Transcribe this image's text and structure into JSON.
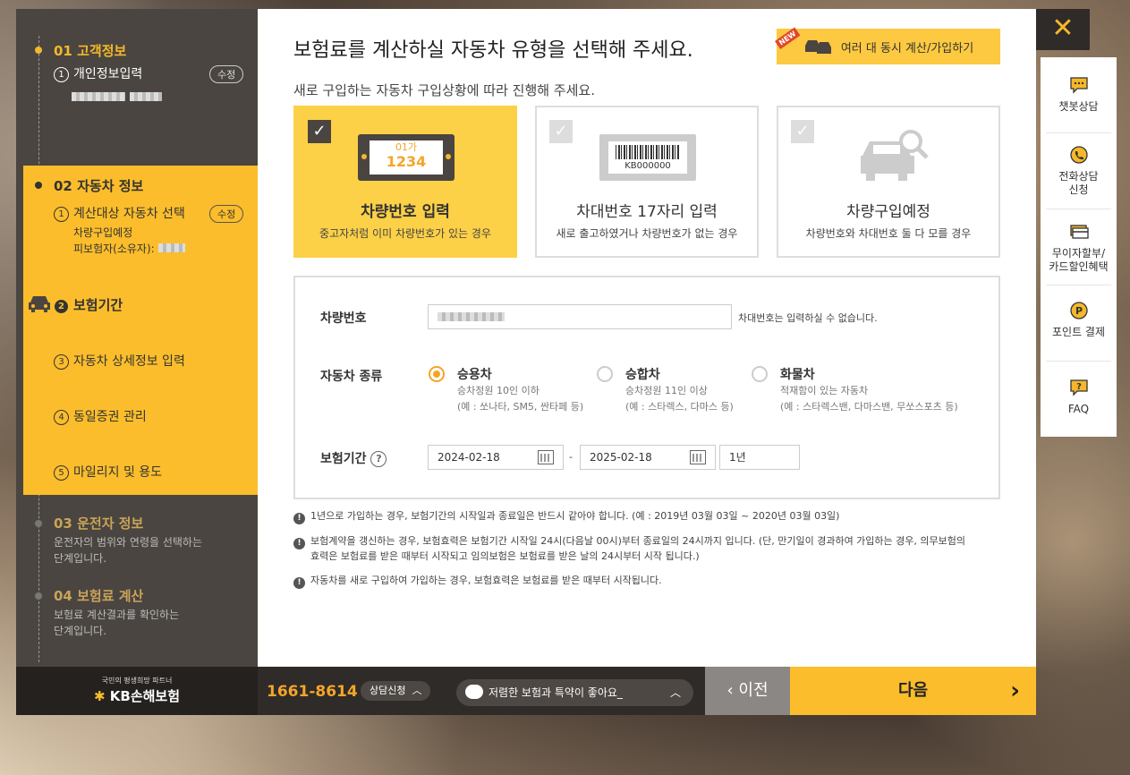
{
  "sidebar": {
    "step1": {
      "num": "01",
      "title": "고객정보",
      "sub_num": "1",
      "sub_label": "개인정보입력",
      "edit": "수정"
    },
    "step2": {
      "num": "02",
      "title": "자동차 정보",
      "sub_num": "1",
      "sub_label": "계산대상 자동차 선택",
      "edit": "수정",
      "detail1": "차량구입예정",
      "detail2": "피보험자(소유자):",
      "items": [
        {
          "num": "2",
          "label": "보험기간"
        },
        {
          "num": "3",
          "label": "자동차 상세정보 입력"
        },
        {
          "num": "4",
          "label": "동일증권 관리"
        },
        {
          "num": "5",
          "label": "마일리지 및 용도"
        }
      ]
    },
    "step3": {
      "num": "03",
      "title": "운전자 정보",
      "desc1": "운전자의 범위와 연령을 선택하는",
      "desc2": "단계입니다."
    },
    "step4": {
      "num": "04",
      "title": "보험료 계산",
      "desc1": "보험료 계산결과를 확인하는",
      "desc2": "단계입니다."
    }
  },
  "main": {
    "heading": "보험료를 계산하실 자동차 유형을 선택해 주세요.",
    "subheading": "새로 구입하는 자동차 구입상황에 따라 진행해 주세요.",
    "multi_button": {
      "badge": "NEW",
      "label": "여러 대 동시 계산/가입하기"
    },
    "cards": [
      {
        "title": "차량번호 입력",
        "desc": "중고자처럼 이미 차량번호가 있는 경우",
        "plate_top": "01가",
        "plate_num": "1234",
        "selected": true
      },
      {
        "title": "차대번호 17자리 입력",
        "desc": "새로 출고하였거나 차량번호가 없는 경우",
        "code": "KB000000",
        "selected": false
      },
      {
        "title": "차량구입예정",
        "desc": "차량번호와 차대번호 둘 다 모를 경우",
        "selected": false
      }
    ],
    "form": {
      "plate_label": "차량번호",
      "plate_note": "차대번호는 입력하실 수 없습니다.",
      "type_label": "자동차 종류",
      "types": [
        {
          "title": "승용차",
          "sub1": "승차정원 10인 이하",
          "sub2": "(예 : 쏘나타, SM5, 싼타페 등)",
          "checked": true
        },
        {
          "title": "승합차",
          "sub1": "승차정원 11인 이상",
          "sub2": "(예 : 스타렉스, 다마스 등)",
          "checked": false
        },
        {
          "title": "화물차",
          "sub1": "적재함이 있는 자동차",
          "sub2": "(예 : 스타렉스밴, 다마스밴, 무쏘스포츠 등)",
          "checked": false
        }
      ],
      "period_label": "보험기간",
      "start_date": "2024-02-18",
      "end_date": "2025-02-18",
      "dash": "-",
      "duration": "1년"
    },
    "notices": [
      "1년으로 가입하는 경우, 보험기간의 시작일과 종료일은 반드시 같아야 합니다. (예 : 2019년 03월 03일 ~ 2020년 03월 03일)",
      "보험계약을 갱신하는 경우, 보험효력은 보험기간 시작일 24시(다음날 00시)부터 종료일의 24시까지 입니다. (단, 만기일이 경과하여 가입하는 경우, 의무보험의",
      "효력은 보험료를 받은 때부터 시작되고 임의보험은 보험료를 받은 날의 24시부터 시작 됩니다.)",
      "자동차를 새로 구입하여 가입하는 경우, 보험효력은 보험료를 받은 때부터 시작됩니다."
    ]
  },
  "right_panel": {
    "close": "✕",
    "items": [
      {
        "label": "챗봇상담"
      },
      {
        "label1": "전화상담",
        "label2": "신청"
      },
      {
        "label1": "무이자할부/",
        "label2": "카드할인혜택"
      },
      {
        "label": "포인트 결제"
      },
      {
        "label": "FAQ"
      }
    ]
  },
  "footer": {
    "logo_tag": "국민의 평생희망 파트너",
    "logo_name": "KB손해보험",
    "phone": "1661-8614",
    "consult": "상담신청",
    "chat": "저렴한 보험과 특약이 좋아요_",
    "prev": "이전",
    "next": "다음"
  },
  "colors": {
    "accent": "#fbbd2b",
    "dark": "#4a4540",
    "orange": "#f4a52a"
  }
}
